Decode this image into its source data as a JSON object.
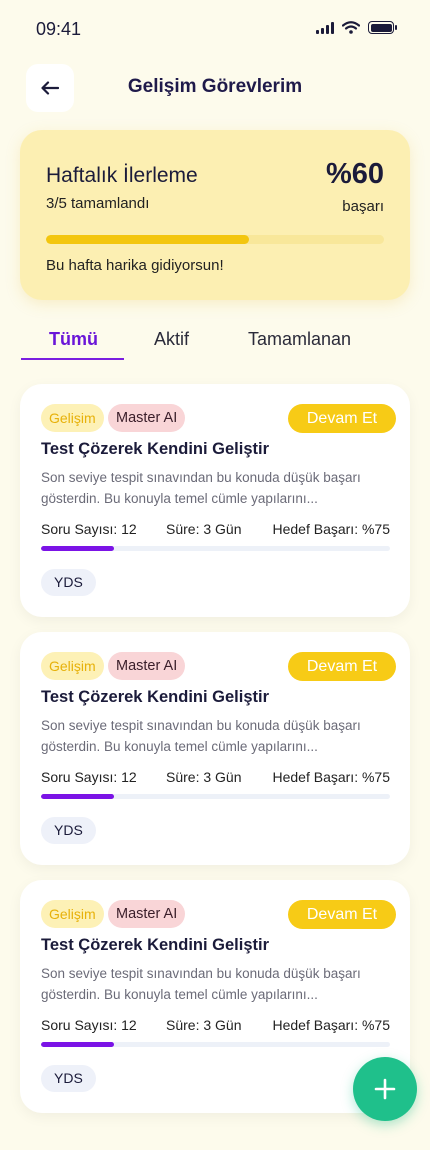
{
  "status_bar": {
    "time": "09:41"
  },
  "header": {
    "title": "Gelişim Görevlerim"
  },
  "progress": {
    "title": "Haftalık İlerleme",
    "completed_text": "3/5 tamamlandı",
    "percent_text": "%60",
    "success_label": "başarı",
    "progress_fraction": 0.6,
    "message": "Bu hafta harika gidiyorsun!"
  },
  "tabs": [
    {
      "label": "Tümü",
      "active": true
    },
    {
      "label": "Aktif",
      "active": false
    },
    {
      "label": "Tamamlanan",
      "active": false
    }
  ],
  "tasks": [
    {
      "category": "Gelişim",
      "source": "Master AI",
      "status": "Devam Et",
      "title": "Test Çözerek Kendini Geliştir",
      "description": "Son seviye tespit sınavından bu konuda düşük başarı gösterdin. Bu konuyla temel cümle yapılarını...",
      "question_count": "Soru Sayısı: 12",
      "duration": "Süre: 3 Gün",
      "target": "Hedef Başarı: %75",
      "progress_fraction": 0.21,
      "exam": "YDS"
    },
    {
      "category": "Gelişim",
      "source": "Master AI",
      "status": "Devam Et",
      "title": "Test Çözerek Kendini Geliştir",
      "description": "Son seviye tespit sınavından bu konuda düşük başarı gösterdin. Bu konuyla temel cümle yapılarını...",
      "question_count": "Soru Sayısı: 12",
      "duration": "Süre: 3 Gün",
      "target": "Hedef Başarı: %75",
      "progress_fraction": 0.21,
      "exam": "YDS"
    },
    {
      "category": "Gelişim",
      "source": "Master AI",
      "status": "Devam Et",
      "title": "Test Çözerek Kendini Geliştir",
      "description": "Son seviye tespit sınavından bu konuda düşük başarı gösterdin. Bu konuyla temel cümle yapılarını...",
      "question_count": "Soru Sayısı: 12",
      "duration": "Süre: 3 Gün",
      "target": "Hedef Başarı: %75",
      "progress_fraction": 0.21,
      "exam": "YDS"
    }
  ],
  "icons": {
    "back": "arrow-left-icon",
    "add": "plus-icon",
    "signal": "signal-icon",
    "wifi": "wifi-icon",
    "battery": "battery-icon"
  },
  "colors": {
    "accent_purple": "#7b13e6",
    "status_yellow": "#f7cb16",
    "fab_green": "#1fc08b"
  }
}
